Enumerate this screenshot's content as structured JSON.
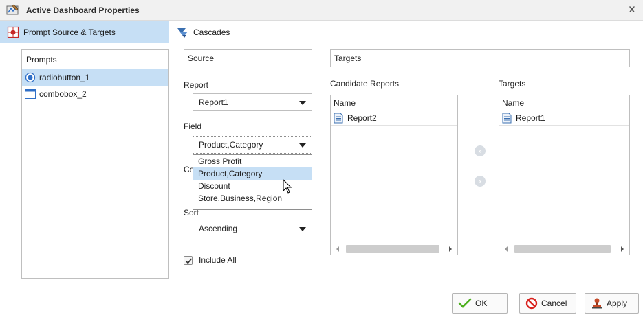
{
  "window": {
    "title": "Active Dashboard Properties",
    "close_glyph": "x"
  },
  "tabs": [
    {
      "label": "Prompt Source & Targets",
      "icon": "source-targets-icon",
      "active": true
    },
    {
      "label": "Cascades",
      "icon": "cascades-icon",
      "active": false
    }
  ],
  "prompts": {
    "header": "Prompts",
    "items": [
      {
        "label": "radiobutton_1",
        "icon": "radio-button-icon",
        "selected": true
      },
      {
        "label": "combobox_2",
        "icon": "combobox-icon",
        "selected": false
      }
    ]
  },
  "source": {
    "header": "Source",
    "report_label": "Report",
    "report_value": "Report1",
    "field_label": "Field",
    "field_value": "Product,Category",
    "field_options": [
      "Gross Profit",
      "Product,Category",
      "Discount",
      "Store,Business,Region"
    ],
    "hidden_label_fragment": "Co",
    "sort_label_fragment": "Sort",
    "sort_value": "Ascending",
    "include_all_label": "Include All",
    "include_all_checked": true
  },
  "targets": {
    "header": "Targets",
    "candidate_label": "Candidate Reports",
    "candidate_column": "Name",
    "candidate_rows": [
      "Report2"
    ],
    "targets_label": "Targets",
    "targets_column": "Name",
    "targets_rows": [
      "Report1"
    ],
    "move_right_glyph": "»",
    "move_left_glyph": "«"
  },
  "buttons": {
    "ok": "OK",
    "cancel": "Cancel",
    "apply": "Apply"
  },
  "colors": {
    "selection": "#c6dff5",
    "ok_check": "#4caf1d",
    "cancel_red": "#d8231f",
    "radio_blue": "#2f6fc7"
  }
}
